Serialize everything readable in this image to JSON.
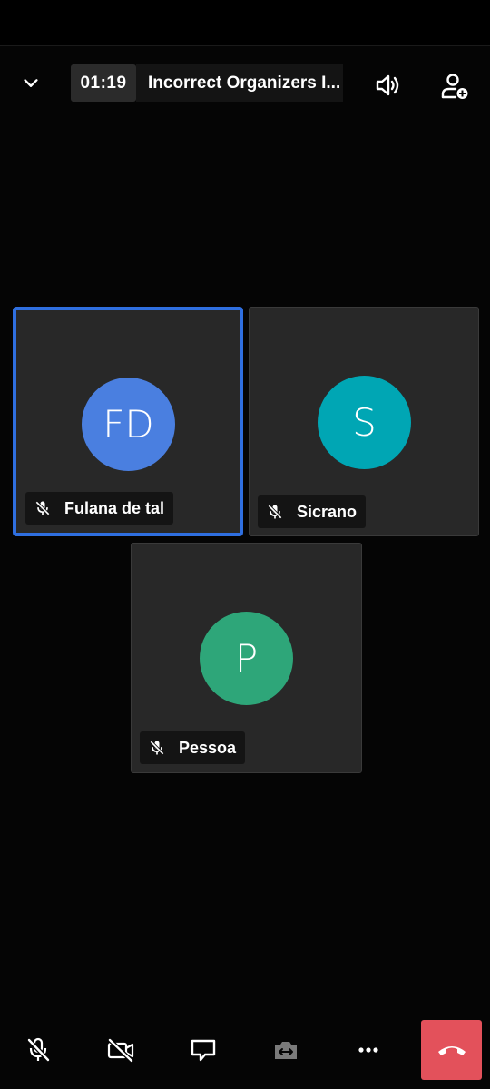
{
  "header": {
    "timer": "01:19",
    "meeting_title": "Incorrect Organizers I...",
    "icons": [
      "chevron-down-icon",
      "speaker-icon",
      "add-person-icon"
    ]
  },
  "participants": [
    {
      "initials": "FD",
      "name": "Fulana de tal",
      "avatar_color": "#4a7fe0",
      "muted": true,
      "active_speaker": true
    },
    {
      "initials": "S",
      "name": "Sicrano",
      "avatar_color": "#00a6b4",
      "muted": true,
      "active_speaker": false
    },
    {
      "initials": "P",
      "name": "Pessoa",
      "avatar_color": "#2ea679",
      "muted": true,
      "active_speaker": false
    }
  ],
  "controls": [
    "mic-off-icon",
    "camera-off-icon",
    "chat-icon",
    "switch-camera-icon",
    "more-icon",
    "hang-up-icon"
  ],
  "colors": {
    "active_border": "#2f6fe0",
    "hangup": "#e3515b",
    "tile": "#282828"
  }
}
